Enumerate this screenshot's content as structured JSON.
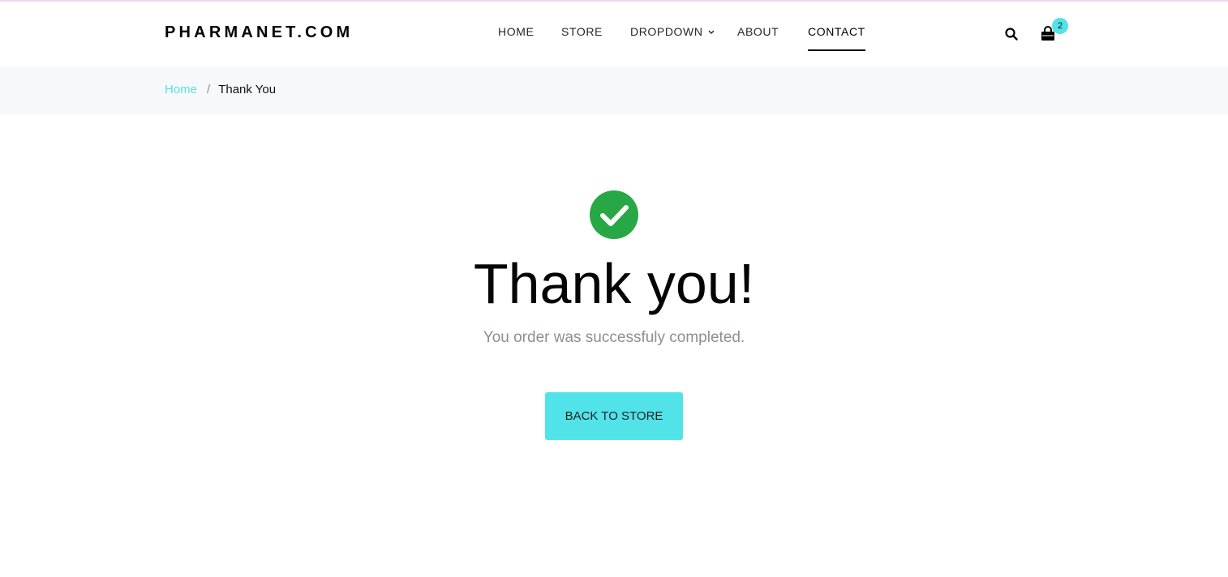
{
  "colors": {
    "accent": "#52e3e9",
    "success": "#28a745",
    "muted_text": "#8a8f96",
    "breadcrumb_bg": "#f7f8f9"
  },
  "header": {
    "logo": "PHARMANET.COM",
    "nav": [
      {
        "label": "HOME"
      },
      {
        "label": "STORE"
      },
      {
        "label": "DROPDOWN",
        "icon": "chevron-down-icon"
      },
      {
        "label": "ABOUT"
      },
      {
        "label": "CONTACT",
        "active": true
      }
    ],
    "search_icon": "search-icon",
    "cart_icon": "shopping-bag-icon",
    "cart_count": "2"
  },
  "breadcrumb": {
    "home": "Home",
    "separator": "/",
    "current": "Thank You"
  },
  "main": {
    "status_icon": "check-circle-icon",
    "title": "Thank you!",
    "message": "You order was successfuly completed.",
    "button_label": "BACK TO STORE"
  }
}
